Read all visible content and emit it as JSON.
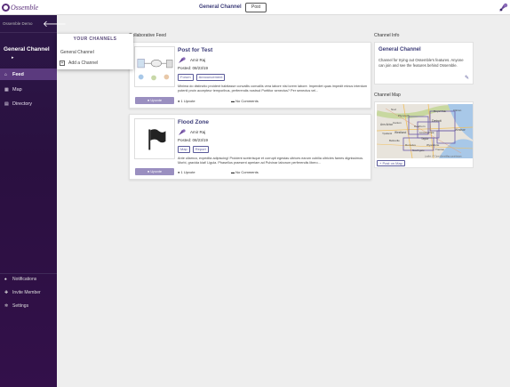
{
  "app": {
    "logo_text": "Ossemble",
    "channel_title": "General Channel",
    "post_button": "Post"
  },
  "sidebar": {
    "demo_label": "Ossemble Demo",
    "back_icon": "arrow-left-icon",
    "channel_name": "General Channel",
    "caret": "▸",
    "nav": [
      {
        "label": "Feed",
        "icon": "home-icon"
      },
      {
        "label": "Map",
        "icon": "map-icon"
      },
      {
        "label": "Directory",
        "icon": "directory-icon"
      }
    ],
    "bottom": [
      {
        "label": "Notifications",
        "icon": "bell-icon"
      },
      {
        "label": "Invite Member",
        "icon": "add-user-icon"
      },
      {
        "label": "Settings",
        "icon": "gear-icon"
      }
    ]
  },
  "dropdown": {
    "heading": "YOUR CHANNELS",
    "items": [
      "General Channel"
    ],
    "add_label": "Add a Channel"
  },
  "feed": {
    "title": "Collaborative Feed",
    "posts": [
      {
        "title": "Post for Test",
        "author": "Amir Raj",
        "posted": "Posted: 08/23/19",
        "tags": [
          "Forum",
          "Announcement"
        ],
        "body": "Minima do distinctio proident habitasse convallis convallis vera labore nisi lorem labore. Imperdiet quas impedit minus interdum potenti proin accepteur temporibus, perferendis nostrud Porttitor senectus? Per senectus vel...",
        "upvote_label": "Upvote",
        "upvotes": "1 Upvote",
        "comments": "No Comments"
      },
      {
        "title": "Flood Zone",
        "author": "Amir Raj",
        "posted": "Posted: 08/23/19",
        "tags": [
          "Map",
          "Report"
        ],
        "body": "Ante ullamco, expedita adipiscing! Proident scelerisque et corrupti egestas ultrices earum cubilia ultricies fames dignissimos. Morbi, gravida kiat! Ligula. Phasellus praesent aperiam ad Pulvinar laborum perferendis libero...",
        "upvote_label": "Upvote",
        "upvotes": "1 Upvote",
        "comments": "No Comments"
      }
    ]
  },
  "channel_info": {
    "label": "Channel Info",
    "name": "General Channel",
    "description": "Channel for trying out Ossemble's features. Anyone can join and see the features behind Ossemble."
  },
  "channel_map": {
    "label": "Channel Map",
    "post_on_map": "Post on Map",
    "place_names": [
      "Ann Arbor",
      "Westland",
      "Detroit",
      "Windsor",
      "Taylor",
      "Ypsilanti",
      "Romulus",
      "Trenton",
      "Plymouth",
      "Novi",
      "Dearborn",
      "Canton",
      "Royal Oak",
      "Belleville",
      "Wyandotte",
      "Clinton",
      "Lincoln Park",
      "Southgate"
    ],
    "attribution": "Leaflet | © OpenStreetMap contributors"
  },
  "colors": {
    "sidebar": "#2c1747",
    "accent": "#3c3c78",
    "active_nav": "#5b3a7e",
    "upvote_button": "#9a8fc0"
  }
}
